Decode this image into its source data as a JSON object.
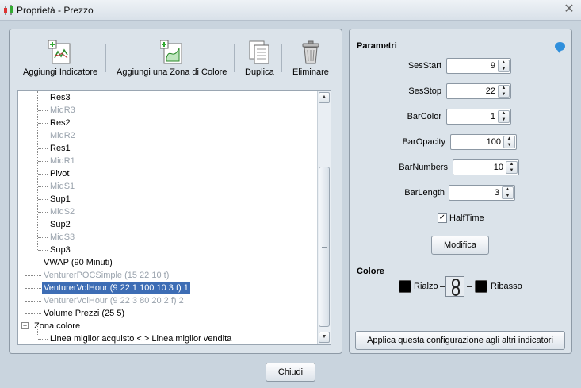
{
  "window": {
    "title": "Proprietà - Prezzo"
  },
  "toolbar": {
    "add_indicator": "Aggiungi Indicatore",
    "add_color_zone": "Aggiungi una Zona di Colore",
    "duplicate": "Duplica",
    "delete": "Eliminare"
  },
  "tree": {
    "items": [
      {
        "label": "Res3",
        "dim": false
      },
      {
        "label": "MidR3",
        "dim": true
      },
      {
        "label": "Res2",
        "dim": false
      },
      {
        "label": "MidR2",
        "dim": true
      },
      {
        "label": "Res1",
        "dim": false
      },
      {
        "label": "MidR1",
        "dim": true
      },
      {
        "label": "Pivot",
        "dim": false
      },
      {
        "label": "MidS1",
        "dim": true
      },
      {
        "label": "Sup1",
        "dim": false
      },
      {
        "label": "MidS2",
        "dim": true
      },
      {
        "label": "Sup2",
        "dim": false
      },
      {
        "label": "MidS3",
        "dim": true
      },
      {
        "label": "Sup3",
        "dim": false
      },
      {
        "label": "VWAP (90 Minuti)",
        "dim": false
      },
      {
        "label": "VenturerPOCSimple (15 22 10 t)",
        "dim": true
      },
      {
        "label": "VenturerVolHour (9 22 1 100 10 3 t) 1",
        "dim": true,
        "selected": true
      },
      {
        "label": "VenturerVolHour (9 22 3 80 20 2 f) 2",
        "dim": true
      },
      {
        "label": "Volume Prezzi (25 5)",
        "dim": false
      },
      {
        "label": "Zona colore",
        "dim": false
      },
      {
        "label": "Linea miglior acquisto < > Linea miglior vendita",
        "dim": false
      }
    ]
  },
  "params": {
    "title": "Parametri",
    "fields": [
      {
        "label": "SesStart",
        "value": "9"
      },
      {
        "label": "SesStop",
        "value": "22"
      },
      {
        "label": "BarColor",
        "value": "1"
      },
      {
        "label": "BarOpacity",
        "value": "100"
      },
      {
        "label": "BarNumbers",
        "value": "10"
      },
      {
        "label": "BarLength",
        "value": "3"
      }
    ],
    "halftime_label": "HalfTime",
    "halftime_checked": true,
    "modify_label": "Modifica"
  },
  "colors": {
    "title": "Colore",
    "rise_label": "Rialzo",
    "fall_label": "Ribasso",
    "rise_color": "#000000",
    "fall_color": "#000000"
  },
  "apply_label": "Applica questa configurazione agli altri indicatori",
  "close_label": "Chiudi"
}
